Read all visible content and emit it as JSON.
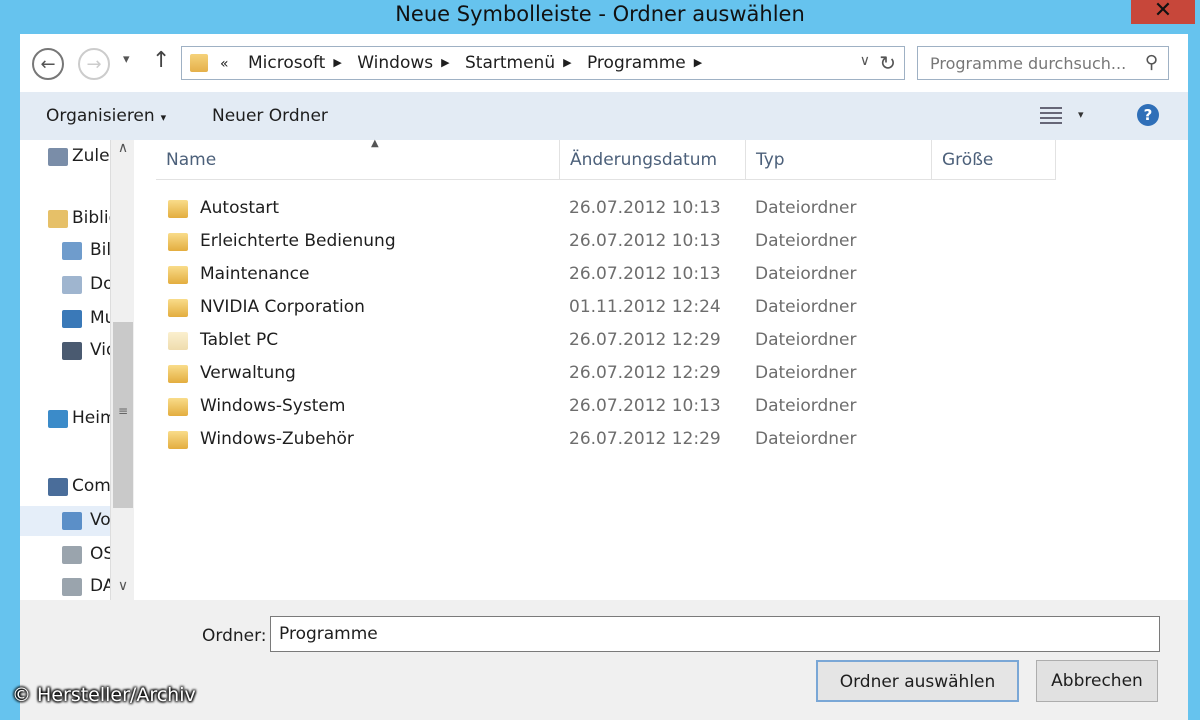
{
  "window": {
    "title": "Neue Symbolleiste - Ordner auswählen",
    "close_glyph": "✕"
  },
  "nav": {
    "back_glyph": "←",
    "forward_glyph": "→",
    "history_glyph": "▾",
    "up_glyph": "↑",
    "breadcrumb_overflow": "«",
    "breadcrumb_separator": "▶",
    "breadcrumbs": [
      "Microsoft",
      "Windows",
      "Startmenü",
      "Programme"
    ],
    "dropdown_glyph": "∨",
    "refresh_glyph": "↻"
  },
  "search": {
    "placeholder": "Programme durchsuch...",
    "icon_glyph": "⚲"
  },
  "toolbar": {
    "organize_label": "Organisieren",
    "organize_caret": "▾",
    "new_folder_label": "Neuer Ordner",
    "view_caret": "▾",
    "help_glyph": "?"
  },
  "navpane": {
    "items": [
      {
        "label": "Zuletzt besucht",
        "icon": "recent-places-icon",
        "color": "#7a8da8"
      },
      {
        "label": "Bibliotheken",
        "icon": "libraries-icon",
        "color": "#e6c068"
      },
      {
        "label": "Bilder",
        "icon": "pictures-icon",
        "color": "#6f9ccc"
      },
      {
        "label": "Dokumente",
        "icon": "documents-icon",
        "color": "#9fb5cf"
      },
      {
        "label": "Musik",
        "icon": "music-icon",
        "color": "#3a79b8"
      },
      {
        "label": "Videos",
        "icon": "videos-icon",
        "color": "#4a5a70"
      },
      {
        "label": "Heimnetzgruppe",
        "icon": "homegroup-icon",
        "color": "#3b8bc9"
      },
      {
        "label": "Computer",
        "icon": "computer-icon",
        "color": "#4a6d9a"
      },
      {
        "label": "Volume",
        "icon": "drive-icon",
        "color": "#5b8fc8"
      },
      {
        "label": "OS",
        "icon": "drive-icon",
        "color": "#9aa4ad"
      },
      {
        "label": "DATA",
        "icon": "drive-icon",
        "color": "#9aa4ad"
      }
    ],
    "scroll_up": "∧",
    "scroll_down": "∨",
    "scroll_grip": "≡"
  },
  "filelist": {
    "columns": [
      "Name",
      "Änderungsdatum",
      "Typ",
      "Größe"
    ],
    "sort_glyph": "▲",
    "rows": [
      {
        "name": "Autostart",
        "date": "26.07.2012 10:13",
        "type": "Dateiordner",
        "pale": false
      },
      {
        "name": "Erleichterte Bedienung",
        "date": "26.07.2012 10:13",
        "type": "Dateiordner",
        "pale": false
      },
      {
        "name": "Maintenance",
        "date": "26.07.2012 10:13",
        "type": "Dateiordner",
        "pale": false
      },
      {
        "name": "NVIDIA Corporation",
        "date": "01.11.2012 12:24",
        "type": "Dateiordner",
        "pale": false
      },
      {
        "name": "Tablet PC",
        "date": "26.07.2012 12:29",
        "type": "Dateiordner",
        "pale": true
      },
      {
        "name": "Verwaltung",
        "date": "26.07.2012 12:29",
        "type": "Dateiordner",
        "pale": false
      },
      {
        "name": "Windows-System",
        "date": "26.07.2012 10:13",
        "type": "Dateiordner",
        "pale": false
      },
      {
        "name": "Windows-Zubehör",
        "date": "26.07.2012 12:29",
        "type": "Dateiordner",
        "pale": false
      }
    ]
  },
  "footer": {
    "folder_label": "Ordner:",
    "folder_value": "Programme",
    "select_button": "Ordner auswählen",
    "cancel_button": "Abbrechen"
  },
  "watermark": "© Hersteller/Archiv",
  "colors": {
    "accent": "#66c3ee",
    "toolbar": "#e3ebf4",
    "header_text": "#4c607a"
  }
}
